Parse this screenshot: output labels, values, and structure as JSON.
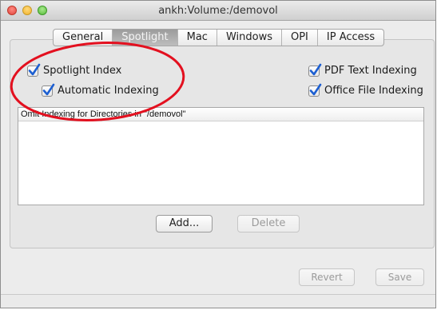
{
  "window": {
    "title": "ankh:Volume:/demovol"
  },
  "tabs": [
    {
      "label": "General",
      "active": false
    },
    {
      "label": "Spotlight",
      "active": true
    },
    {
      "label": "Mac",
      "active": false
    },
    {
      "label": "Windows",
      "active": false
    },
    {
      "label": "OPI",
      "active": false
    },
    {
      "label": "IP Access",
      "active": false
    }
  ],
  "options": {
    "spotlight_index": {
      "label": "Spotlight Index",
      "checked": true
    },
    "automatic_indexing": {
      "label": "Automatic Indexing",
      "checked": true
    },
    "pdf_text_indexing": {
      "label": "PDF Text Indexing",
      "checked": true
    },
    "office_file_indexing": {
      "label": "Office File Indexing",
      "checked": true
    }
  },
  "omit_table": {
    "header": "Omit Indexing for Directories in \"/demovol\"",
    "rows": []
  },
  "buttons": {
    "add": "Add...",
    "delete": "Delete",
    "revert": "Revert",
    "save": "Save"
  },
  "colors": {
    "check_accent": "#1d5fd1",
    "annotation_circle": "#e3101f",
    "active_tab": "#a8a8a8"
  }
}
